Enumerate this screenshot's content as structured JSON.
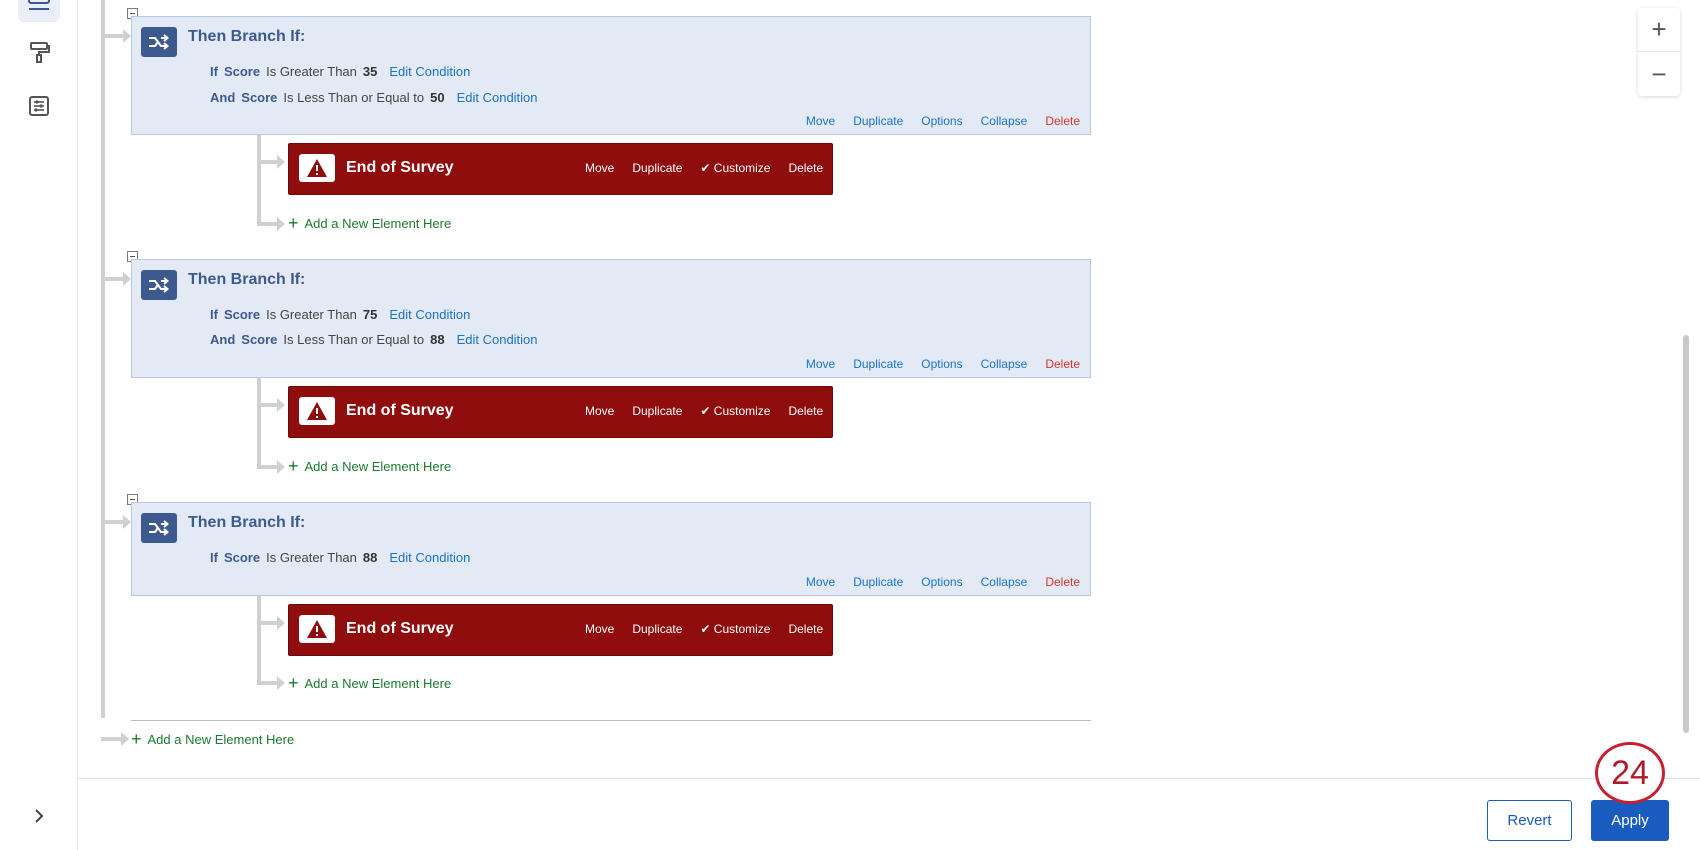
{
  "rail": {
    "items": [
      {
        "icon": "survey-flow-icon"
      },
      {
        "icon": "paint-roller-icon"
      },
      {
        "icon": "sliders-icon"
      }
    ],
    "expand_icon": "chevron-right-icon"
  },
  "branches": [
    {
      "title": "Then Branch If:",
      "conditions": [
        {
          "conj": "If",
          "field": "Score",
          "op": "Is Greater Than",
          "value": "35",
          "edit": "Edit Condition"
        },
        {
          "conj": "And",
          "field": "Score",
          "op": "Is Less Than or Equal to",
          "value": "50",
          "edit": "Edit Condition"
        }
      ],
      "actions": {
        "move": "Move",
        "duplicate": "Duplicate",
        "options": "Options",
        "collapse": "Collapse",
        "delete": "Delete"
      }
    },
    {
      "title": "Then Branch If:",
      "conditions": [
        {
          "conj": "If",
          "field": "Score",
          "op": "Is Greater Than",
          "value": "75",
          "edit": "Edit Condition"
        },
        {
          "conj": "And",
          "field": "Score",
          "op": "Is Less Than or Equal to",
          "value": "88",
          "edit": "Edit Condition"
        }
      ],
      "actions": {
        "move": "Move",
        "duplicate": "Duplicate",
        "options": "Options",
        "collapse": "Collapse",
        "delete": "Delete"
      }
    },
    {
      "title": "Then Branch If:",
      "conditions": [
        {
          "conj": "If",
          "field": "Score",
          "op": "Is Greater Than",
          "value": "88",
          "edit": "Edit Condition"
        }
      ],
      "actions": {
        "move": "Move",
        "duplicate": "Duplicate",
        "options": "Options",
        "collapse": "Collapse",
        "delete": "Delete"
      }
    }
  ],
  "end_of_survey": {
    "title": "End of Survey",
    "move": "Move",
    "duplicate": "Duplicate",
    "customize": "Customize",
    "delete": "Delete"
  },
  "add_element_label": "Add a New Element Here",
  "zoom": {
    "in": "+",
    "out": "−"
  },
  "footer": {
    "revert": "Revert",
    "apply": "Apply"
  },
  "step_badge": "24",
  "colors": {
    "branch_bg": "#e3eaf5",
    "eos_bg": "#8f0d0d",
    "link": "#1a73c9",
    "add_green": "#1b7a2d",
    "apply_blue": "#1a5bbf",
    "delete_red": "#d9342b"
  }
}
